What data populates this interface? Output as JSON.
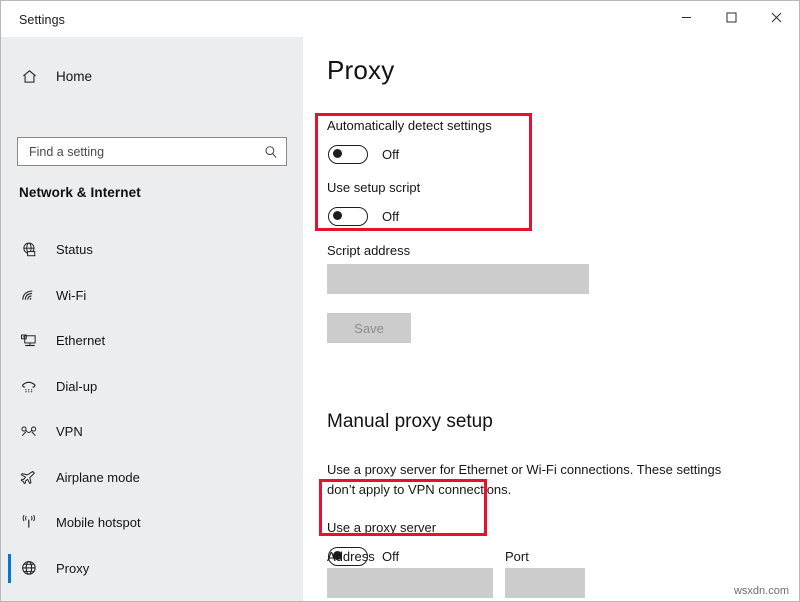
{
  "window": {
    "title": "Settings",
    "controls": [
      {
        "name": "minimize",
        "label": "─"
      },
      {
        "name": "maximize",
        "label": "□"
      },
      {
        "name": "close",
        "label": "✕"
      }
    ]
  },
  "sidebar": {
    "home": {
      "label": "Home",
      "icon": "home-icon"
    },
    "search": {
      "value": "",
      "placeholder": "Find a setting",
      "icon": "search-icon"
    },
    "category": "Network & Internet",
    "items": [
      {
        "label": "Status",
        "icon": "globe-status-icon",
        "selected": false
      },
      {
        "label": "Wi-Fi",
        "icon": "wifi-icon",
        "selected": false
      },
      {
        "label": "Ethernet",
        "icon": "ethernet-icon",
        "selected": false
      },
      {
        "label": "Dial-up",
        "icon": "dialup-icon",
        "selected": false
      },
      {
        "label": "VPN",
        "icon": "vpn-icon",
        "selected": false
      },
      {
        "label": "Airplane mode",
        "icon": "airplane-icon",
        "selected": false
      },
      {
        "label": "Mobile hotspot",
        "icon": "hotspot-icon",
        "selected": false
      },
      {
        "label": "Proxy",
        "icon": "globe-icon",
        "selected": true
      }
    ]
  },
  "main": {
    "title": "Proxy",
    "auto_detect": {
      "label": "Automatically detect settings",
      "state": "Off"
    },
    "setup_script": {
      "label": "Use setup script",
      "state": "Off"
    },
    "script_address": {
      "label": "Script address",
      "value": ""
    },
    "save_label": "Save",
    "manual": {
      "title": "Manual proxy setup",
      "description": "Use a proxy server for Ethernet or Wi-Fi connections. These settings don’t apply to VPN connections.",
      "use_proxy": {
        "label": "Use a proxy server",
        "state": "Off"
      },
      "address": {
        "label": "Address",
        "value": ""
      },
      "port": {
        "label": "Port",
        "value": ""
      }
    }
  },
  "annotations": {
    "accent_red": "#e8112d",
    "accent_blue": "#0078d7"
  },
  "watermark": "wsxdn.com"
}
